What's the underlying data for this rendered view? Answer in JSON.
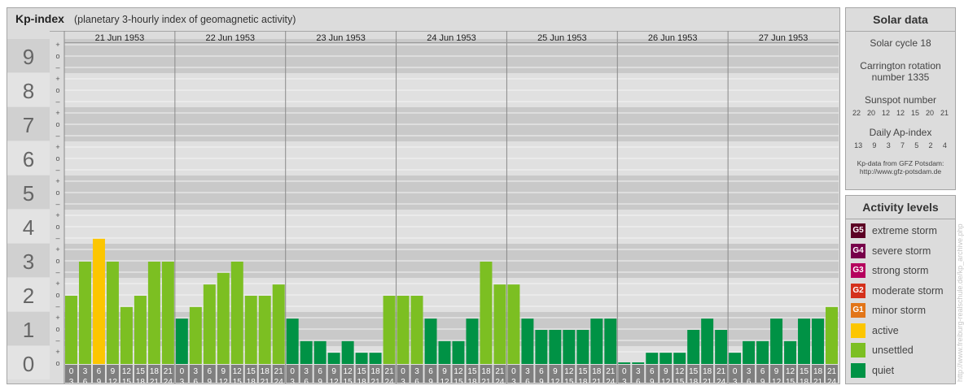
{
  "header": {
    "title": "Kp-index",
    "subtitle": "(planetary 3-hourly index of geomagnetic activity)"
  },
  "chart_data": {
    "type": "bar",
    "ylim": [
      0,
      9
    ],
    "y_ticks": [
      "0",
      "1",
      "2",
      "3",
      "4",
      "5",
      "6",
      "7",
      "8",
      "9"
    ],
    "minor_ticks": [
      "o",
      "+",
      "–"
    ],
    "days": [
      "21 Jun 1953",
      "22 Jun 1953",
      "23 Jun 1953",
      "24 Jun 1953",
      "25 Jun 1953",
      "26 Jun 1953",
      "27 Jun 1953"
    ],
    "interval_top": [
      "0",
      "3",
      "6",
      "9",
      "12",
      "15",
      "18",
      "21"
    ],
    "interval_bottom": [
      "3",
      "6",
      "9",
      "12",
      "15",
      "18",
      "21",
      "24"
    ],
    "values": [
      [
        2,
        3,
        3.67,
        3,
        1.67,
        2,
        3,
        3
      ],
      [
        1.33,
        1.67,
        2.33,
        2.67,
        3,
        2,
        2,
        2.33
      ],
      [
        1.33,
        0.67,
        0.67,
        0.33,
        0.67,
        0.33,
        0.33,
        2
      ],
      [
        2,
        2,
        1.33,
        0.67,
        0.67,
        1.33,
        3,
        2.33
      ],
      [
        2.33,
        1.33,
        1,
        1,
        1,
        1,
        1.33,
        1.33
      ],
      [
        0,
        0,
        0.33,
        0.33,
        0.33,
        1,
        1.33,
        1
      ],
      [
        0.33,
        0.67,
        0.67,
        1.33,
        0.67,
        1.33,
        1.33,
        1.67
      ]
    ],
    "colors": {
      "quiet": "#009245",
      "unsettled": "#7cbf22",
      "active": "#fcc600"
    }
  },
  "solar": {
    "title": "Solar data",
    "cycle": "Solar cycle 18",
    "carrington_1": "Carrington rotation",
    "carrington_2": "number 1335",
    "sunspot_label": "Sunspot number",
    "sunspot": [
      "22",
      "20",
      "12",
      "12",
      "15",
      "20",
      "21"
    ],
    "ap_label": "Daily Ap-index",
    "ap": [
      "13",
      "9",
      "3",
      "7",
      "5",
      "2",
      "4"
    ],
    "source_1": "Kp-data from GFZ Potsdam:",
    "source_2": "http://www.gfz-potsdam.de"
  },
  "legend": {
    "title": "Activity levels",
    "items": [
      {
        "code": "G5",
        "label": "extreme storm",
        "color": "#5c0024"
      },
      {
        "code": "G4",
        "label": "severe storm",
        "color": "#77004a"
      },
      {
        "code": "G3",
        "label": "strong storm",
        "color": "#b5005d"
      },
      {
        "code": "G2",
        "label": "moderate storm",
        "color": "#d4301b"
      },
      {
        "code": "G1",
        "label": "minor storm",
        "color": "#e27518"
      },
      {
        "code": "",
        "label": "active",
        "color": "#fcc600"
      },
      {
        "code": "",
        "label": "unsettled",
        "color": "#7cbf22"
      },
      {
        "code": "",
        "label": "quiet",
        "color": "#009245"
      }
    ]
  },
  "watermark": "http://www.freiburg-realschule.de/kp_archive.php"
}
